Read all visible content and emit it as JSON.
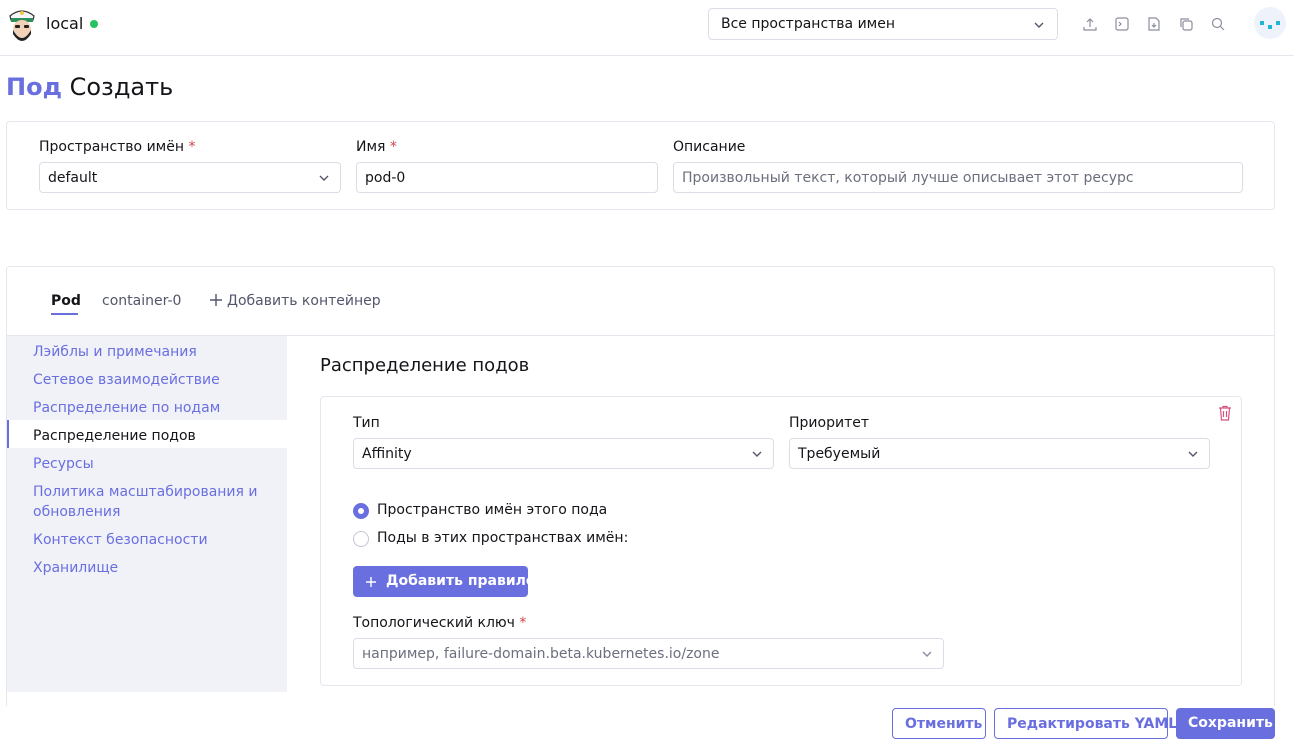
{
  "header": {
    "cluster_name": "local",
    "namespace_select": "Все пространства имен",
    "icons": [
      "upload-icon",
      "terminal-icon",
      "download-icon",
      "copy-icon",
      "search-icon"
    ]
  },
  "title": {
    "resource_link": "Под",
    "action": "Создать"
  },
  "form": {
    "namespace_label": "Пространство имён",
    "namespace_value": "default",
    "name_label": "Имя",
    "name_value": "pod-0",
    "description_label": "Описание",
    "description_placeholder": "Произвольный текст, который лучше описывает этот ресурс",
    "required_mark": "*"
  },
  "tabs": {
    "items": [
      "Pod",
      "container-0"
    ],
    "add_label": "Добавить контейнер"
  },
  "sidebar": {
    "items": [
      "Лэйблы и примечания",
      "Сетевое взаимодействие",
      "Распределение по нодам",
      "Распределение подов",
      "Ресурсы",
      "Политика масштабирования и обновления",
      "Контекст безопасности",
      "Хранилище"
    ],
    "active_index": 3
  },
  "section": {
    "title": "Распределение подов",
    "type_label": "Тип",
    "type_value": "Affinity",
    "priority_label": "Приоритет",
    "priority_value": "Требуемый",
    "radio_this_ns": "Пространство имён этого пода",
    "radio_other_ns": "Поды в этих пространствах имён:",
    "add_rule_button": "Добавить правило",
    "topology_label": "Топологический ключ",
    "topology_placeholder": "например, failure-domain.beta.kubernetes.io/zone"
  },
  "footer": {
    "cancel": "Отменить",
    "edit_yaml": "Редактировать YAML",
    "save": "Сохранить"
  },
  "colors": {
    "accent": "#6a6fe0",
    "status_dot": "#23c35f",
    "required": "#d1444c",
    "sidebar_bg": "#f0f2f8"
  }
}
